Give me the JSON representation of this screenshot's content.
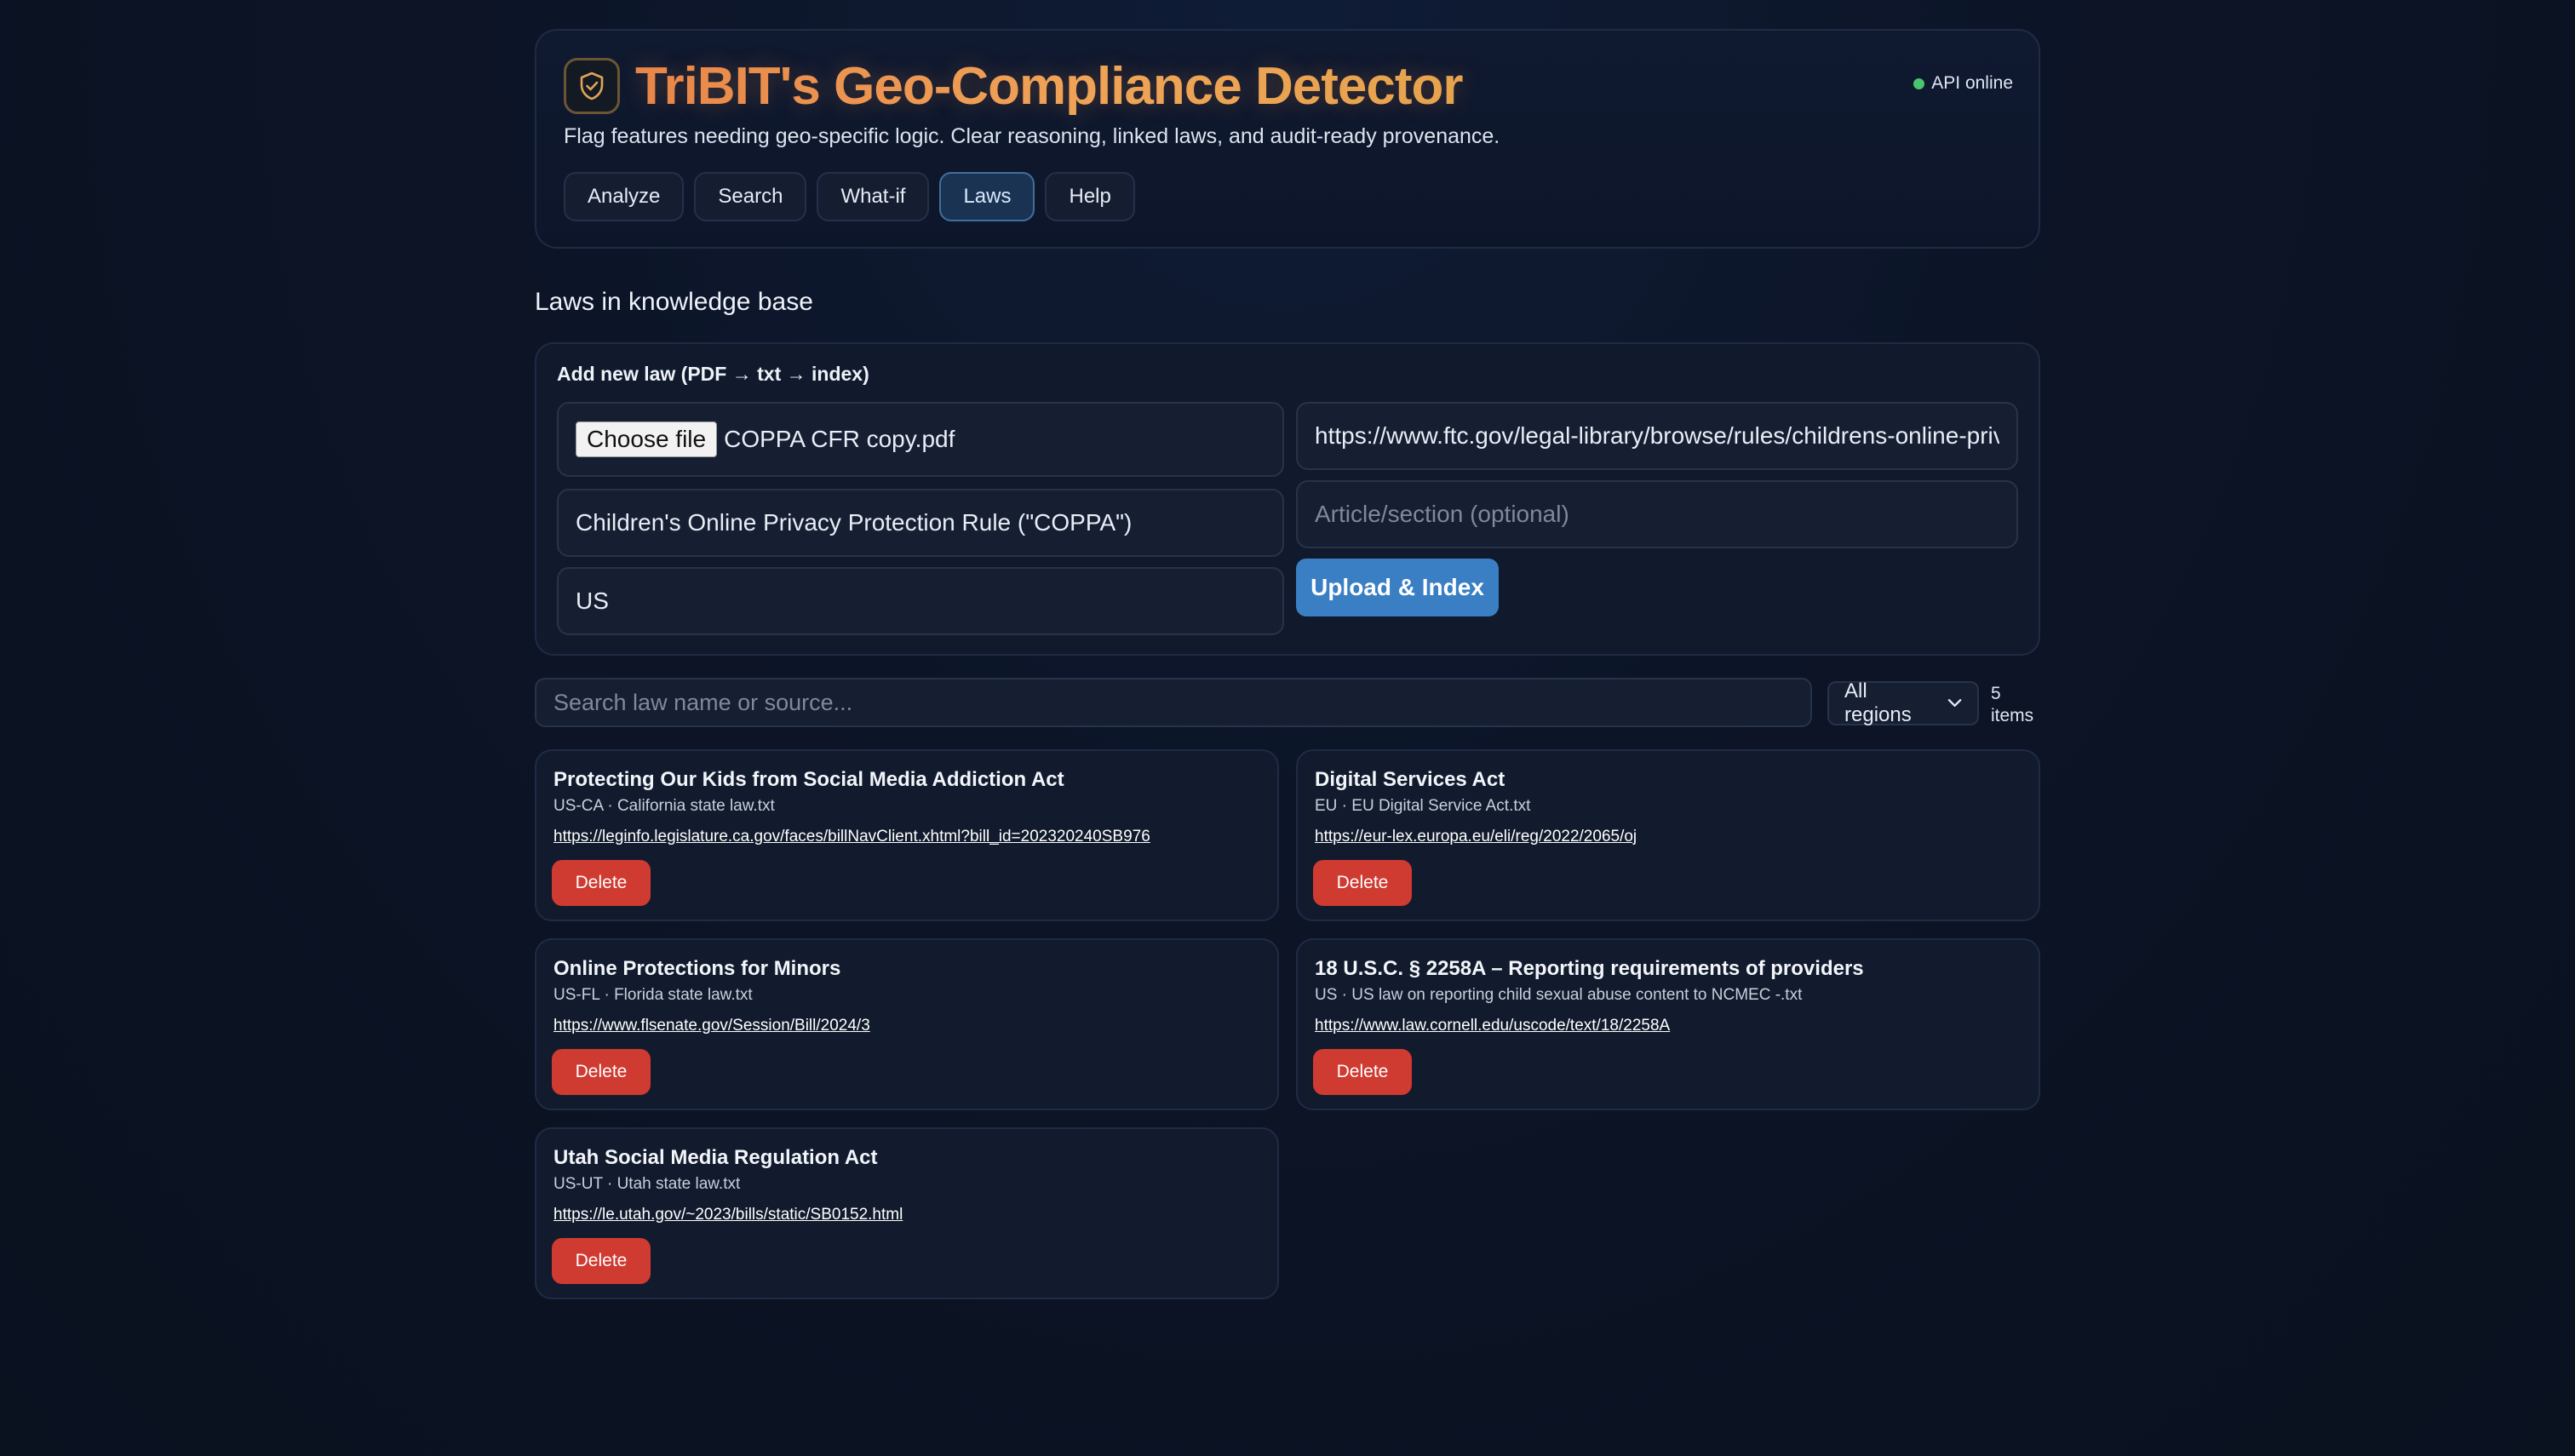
{
  "app": {
    "title": "TriBIT's Geo-Compliance Detector",
    "subtitle": "Flag features needing geo-specific logic. Clear reasoning, linked laws, and audit-ready provenance.",
    "status": "API online",
    "status_color": "#4cc46e"
  },
  "tabs": [
    {
      "label": "Analyze",
      "active": false
    },
    {
      "label": "Search",
      "active": false
    },
    {
      "label": "What-if",
      "active": false
    },
    {
      "label": "Laws",
      "active": true
    },
    {
      "label": "Help",
      "active": false
    }
  ],
  "section_title": "Laws in knowledge base",
  "add_law": {
    "heading": "Add new law (PDF → txt → index)",
    "file_button": "Choose file",
    "file_name": "COPPA CFR copy.pdf",
    "law_name_value": "Children's Online Privacy Protection Rule (\"COPPA\")",
    "region_value": "US",
    "source_url_value": "https://www.ftc.gov/legal-library/browse/rules/childrens-online-privacy-protection-rule-coppa",
    "article_placeholder": "Article/section (optional)",
    "upload_button": "Upload & Index"
  },
  "filter": {
    "search_placeholder": "Search law name or source...",
    "region_selected": "All regions",
    "count_number": "5",
    "count_unit": "items"
  },
  "laws": [
    {
      "name": "Protecting Our Kids from Social Media Addiction Act",
      "meta": "US-CA · California state law.txt",
      "url": "https://leginfo.legislature.ca.gov/faces/billNavClient.xhtml?bill_id=202320240SB976",
      "delete_label": "Delete"
    },
    {
      "name": "Digital Services Act",
      "meta": "EU · EU Digital Service Act.txt",
      "url": "https://eur-lex.europa.eu/eli/reg/2022/2065/oj",
      "delete_label": "Delete"
    },
    {
      "name": "Online Protections for Minors",
      "meta": "US-FL · Florida state law.txt",
      "url": "https://www.flsenate.gov/Session/Bill/2024/3",
      "delete_label": "Delete"
    },
    {
      "name": "18 U.S.C. § 2258A – Reporting requirements of providers",
      "meta": "US · US law on reporting child sexual abuse content to NCMEC -.txt",
      "url": "https://www.law.cornell.edu/uscode/text/18/2258A",
      "delete_label": "Delete"
    },
    {
      "name": "Utah Social Media Regulation Act",
      "meta": "US-UT · Utah state law.txt",
      "url": "https://le.utah.gov/~2023/bills/static/SB0152.html",
      "delete_label": "Delete"
    }
  ]
}
